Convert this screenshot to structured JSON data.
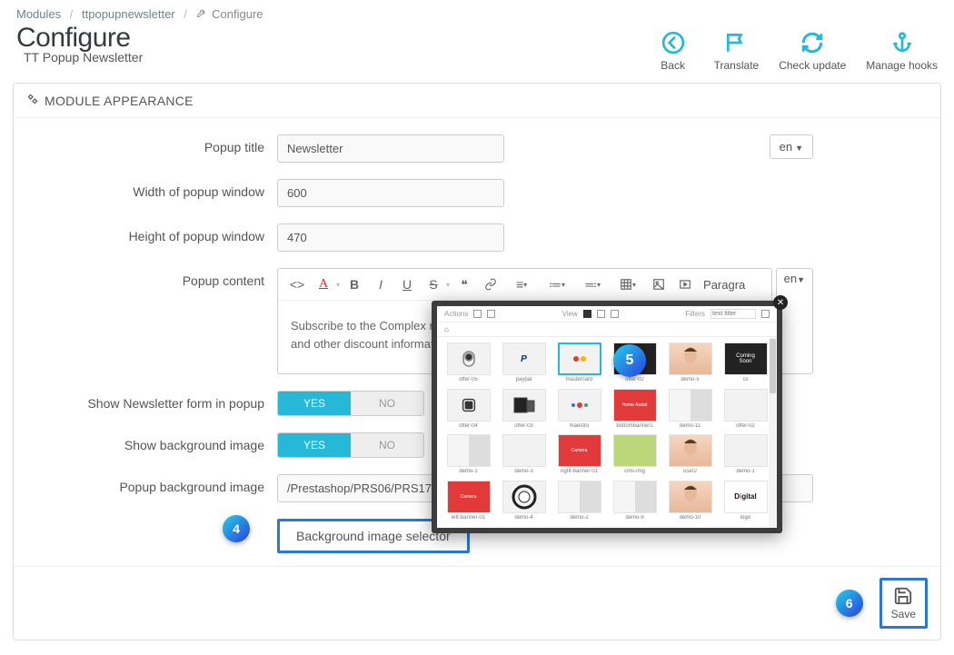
{
  "breadcrumb": {
    "modules": "Modules",
    "module": "ttpopupnewsletter",
    "current": "Configure"
  },
  "page": {
    "title": "Configure",
    "subtitle": "TT Popup Newsletter"
  },
  "toolbar": {
    "back": "Back",
    "translate": "Translate",
    "check_update": "Check update",
    "manage_hooks": "Manage hooks"
  },
  "panel": {
    "heading": "MODULE APPEARANCE"
  },
  "form": {
    "popup_title_label": "Popup title",
    "popup_title_value": "Newsletter",
    "lang": "en",
    "width_label": "Width of popup window",
    "width_value": "600",
    "height_label": "Height of popup window",
    "height_value": "470",
    "content_label": "Popup content",
    "content_value": "Subscribe to the Complex mailing list to receive updates on new arrivals, special offers and other discount information.",
    "editor_paragraph": "Paragra",
    "editor_lang": "en",
    "show_form_label": "Show Newsletter form in popup",
    "show_bg_label": "Show background image",
    "toggle_yes": "YES",
    "toggle_no": "NO",
    "bg_image_label": "Popup background image",
    "bg_image_value": "/Prestashop/PRS06/PRS170_digital/modules/ttpopupnewsletter/views/img/newsletter.jpg",
    "selector_label": "Background image selector"
  },
  "callouts": {
    "four": "4",
    "five": "5",
    "six": "6"
  },
  "footer": {
    "save": "Save"
  },
  "filebrowser": {
    "actions": "Actions",
    "view": "View",
    "filters": "Filters",
    "filter_placeholder": "text filter",
    "home": "⌂",
    "items": [
      {
        "caption": "offer-05",
        "class": ""
      },
      {
        "caption": "paypal",
        "class": ""
      },
      {
        "caption": "mastercard",
        "class": "",
        "selected": true
      },
      {
        "caption": "offer-02",
        "class": "thumb-dark"
      },
      {
        "caption": "demo-5",
        "class": "thumb-face"
      },
      {
        "caption": "cs",
        "class": "thumb-dark"
      },
      {
        "caption": "offer-04",
        "class": ""
      },
      {
        "caption": "offer-03",
        "class": ""
      },
      {
        "caption": "maestro",
        "class": ""
      },
      {
        "caption": "bottombanner1",
        "class": "thumb-red"
      },
      {
        "caption": "demo-11",
        "class": "thumb-split"
      },
      {
        "caption": "offer-02",
        "class": ""
      },
      {
        "caption": "demo-1",
        "class": "thumb-split"
      },
      {
        "caption": "demo-3",
        "class": ""
      },
      {
        "caption": "right-banner-01",
        "class": "thumb-red"
      },
      {
        "caption": "cms-img",
        "class": "thumb-green"
      },
      {
        "caption": "user2",
        "class": "thumb-face"
      },
      {
        "caption": "demo-1",
        "class": ""
      },
      {
        "caption": "left-banner-01",
        "class": "thumb-red"
      },
      {
        "caption": "demo-4",
        "class": ""
      },
      {
        "caption": "demo-2",
        "class": "thumb-split"
      },
      {
        "caption": "demo-9",
        "class": "thumb-split"
      },
      {
        "caption": "demo-10",
        "class": "thumb-face"
      },
      {
        "caption": "logo",
        "class": "thumb-digital"
      }
    ]
  }
}
